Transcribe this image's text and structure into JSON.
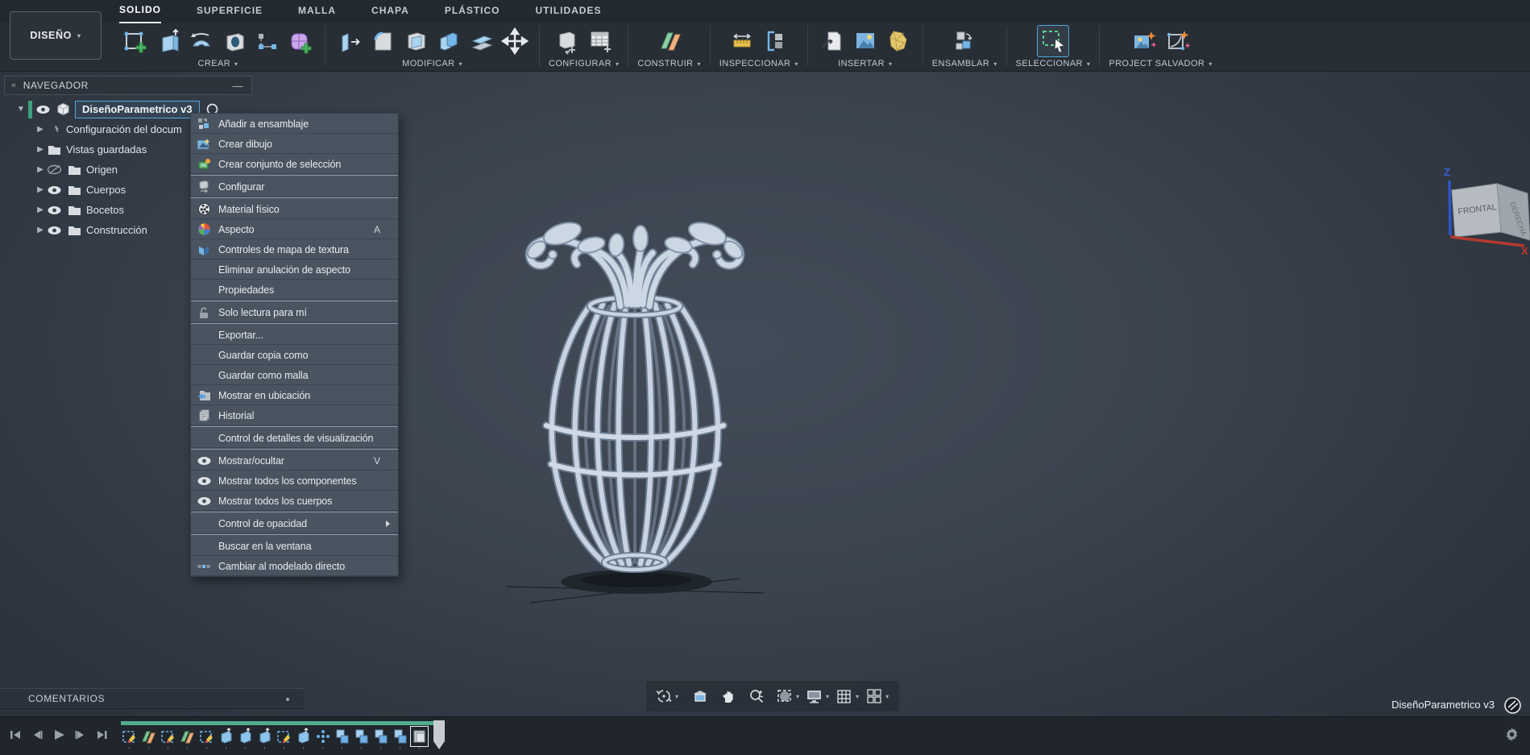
{
  "colors": {
    "accent_green": "#4fae8c",
    "selection_blue": "#57a7dd",
    "menu_bg": "#4a5460",
    "toolbar_bg": "#272e35",
    "timeline_bg": "#20262c",
    "viewport_center": "#424c58"
  },
  "header": {
    "design_button": {
      "label": "DISEÑO"
    },
    "tabs": [
      {
        "label": "SOLIDO",
        "active": true
      },
      {
        "label": "SUPERFICIE"
      },
      {
        "label": "MALLA"
      },
      {
        "label": "CHAPA"
      },
      {
        "label": "PLÁSTICO"
      },
      {
        "label": "UTILIDADES"
      }
    ],
    "groups": [
      {
        "label": "CREAR",
        "icons": [
          "create-sketch",
          "extrude",
          "revolve",
          "hole",
          "rectangular-pattern",
          "create-form"
        ]
      },
      {
        "label": "MODIFICAR",
        "icons": [
          "press-pull",
          "fillet",
          "shell",
          "combine",
          "offset-face",
          "move"
        ]
      },
      {
        "label": "CONFIGURAR",
        "icons": [
          "configure",
          "configuration-table"
        ]
      },
      {
        "label": "CONSTRUIR",
        "icons": [
          "construction-plane"
        ]
      },
      {
        "label": "INSPECCIONAR",
        "icons": [
          "measure",
          "section-analysis"
        ]
      },
      {
        "label": "INSERTAR",
        "icons": [
          "insert-derive",
          "canvas",
          "insert-mesh"
        ]
      },
      {
        "label": "ENSAMBLAR",
        "icons": [
          "new-component"
        ]
      },
      {
        "label": "SELECCIONAR",
        "icons": [
          "select"
        ]
      },
      {
        "label": "PROJECT SALVADOR",
        "icons": [
          "ai-render",
          "ai-sketch"
        ]
      }
    ]
  },
  "navigator": {
    "title": "NAVEGADOR",
    "root": {
      "label": "DiseñoParametrico v3"
    },
    "items": [
      {
        "label": "Configuración del docum",
        "icon": "gear"
      },
      {
        "label": "Vistas guardadas",
        "icon": "folder"
      },
      {
        "label": "Origen",
        "icon": "folder",
        "visibility": "hidden"
      },
      {
        "label": "Cuerpos",
        "icon": "folder",
        "visibility": "visible"
      },
      {
        "label": "Bocetos",
        "icon": "folder",
        "visibility": "visible"
      },
      {
        "label": "Construcción",
        "icon": "folder",
        "visibility": "visible"
      }
    ]
  },
  "context_menu": {
    "items": [
      {
        "label": "Añadir a ensamblaje",
        "icon": "add-to-assembly"
      },
      {
        "label": "Crear dibujo",
        "icon": "create-drawing"
      },
      {
        "label": "Crear conjunto de selección",
        "icon": "selection-set"
      },
      {
        "label": "Configurar",
        "icon": "configure"
      },
      {
        "label": "Material físico",
        "icon": "physical-material"
      },
      {
        "label": "Aspecto",
        "icon": "appearance",
        "shortcut": "A"
      },
      {
        "label": "Controles de mapa de textura",
        "icon": "texture-map"
      },
      {
        "label": "Eliminar anulación de aspecto"
      },
      {
        "label": "Propiedades"
      },
      {
        "label": "Solo lectura para mí",
        "icon": "unlock"
      },
      {
        "label": "Exportar..."
      },
      {
        "label": "Guardar copia como"
      },
      {
        "label": "Guardar como malla"
      },
      {
        "label": "Mostrar en ubicación",
        "icon": "show-location"
      },
      {
        "label": "Historial",
        "icon": "history"
      },
      {
        "label": "Control de detalles de visualización"
      },
      {
        "label": "Mostrar/ocultar",
        "icon": "eye",
        "shortcut": "V"
      },
      {
        "label": "Mostrar todos los componentes",
        "icon": "eye"
      },
      {
        "label": "Mostrar todos los cuerpos",
        "icon": "eye"
      },
      {
        "label": "Control de opacidad",
        "submenu": true
      },
      {
        "label": "Buscar en la ventana"
      },
      {
        "label": "Cambiar al modelado directo",
        "icon": "direct-edit"
      }
    ]
  },
  "viewport": {
    "viewcube": {
      "front": "FRONTAL",
      "right": "DERECHA",
      "axis_z": "Z",
      "axis_x": "X"
    },
    "doc_badge": "DiseñoParametrico v3",
    "nav_bar_icons": [
      "orbit",
      "look-at",
      "pan",
      "zoom",
      "fit",
      "display-settings",
      "grid",
      "viewports"
    ]
  },
  "comments": {
    "title": "COMENTARIOS"
  },
  "timeline": {
    "playback_icons": [
      "skip-start",
      "step-back",
      "play",
      "step-forward",
      "skip-end"
    ],
    "features": [
      "sketch",
      "plane",
      "sketch",
      "plane",
      "sketch",
      "extrude",
      "extrude",
      "extrude",
      "sketch",
      "extrude",
      "pattern",
      "join",
      "join",
      "join",
      "join",
      "end"
    ]
  }
}
